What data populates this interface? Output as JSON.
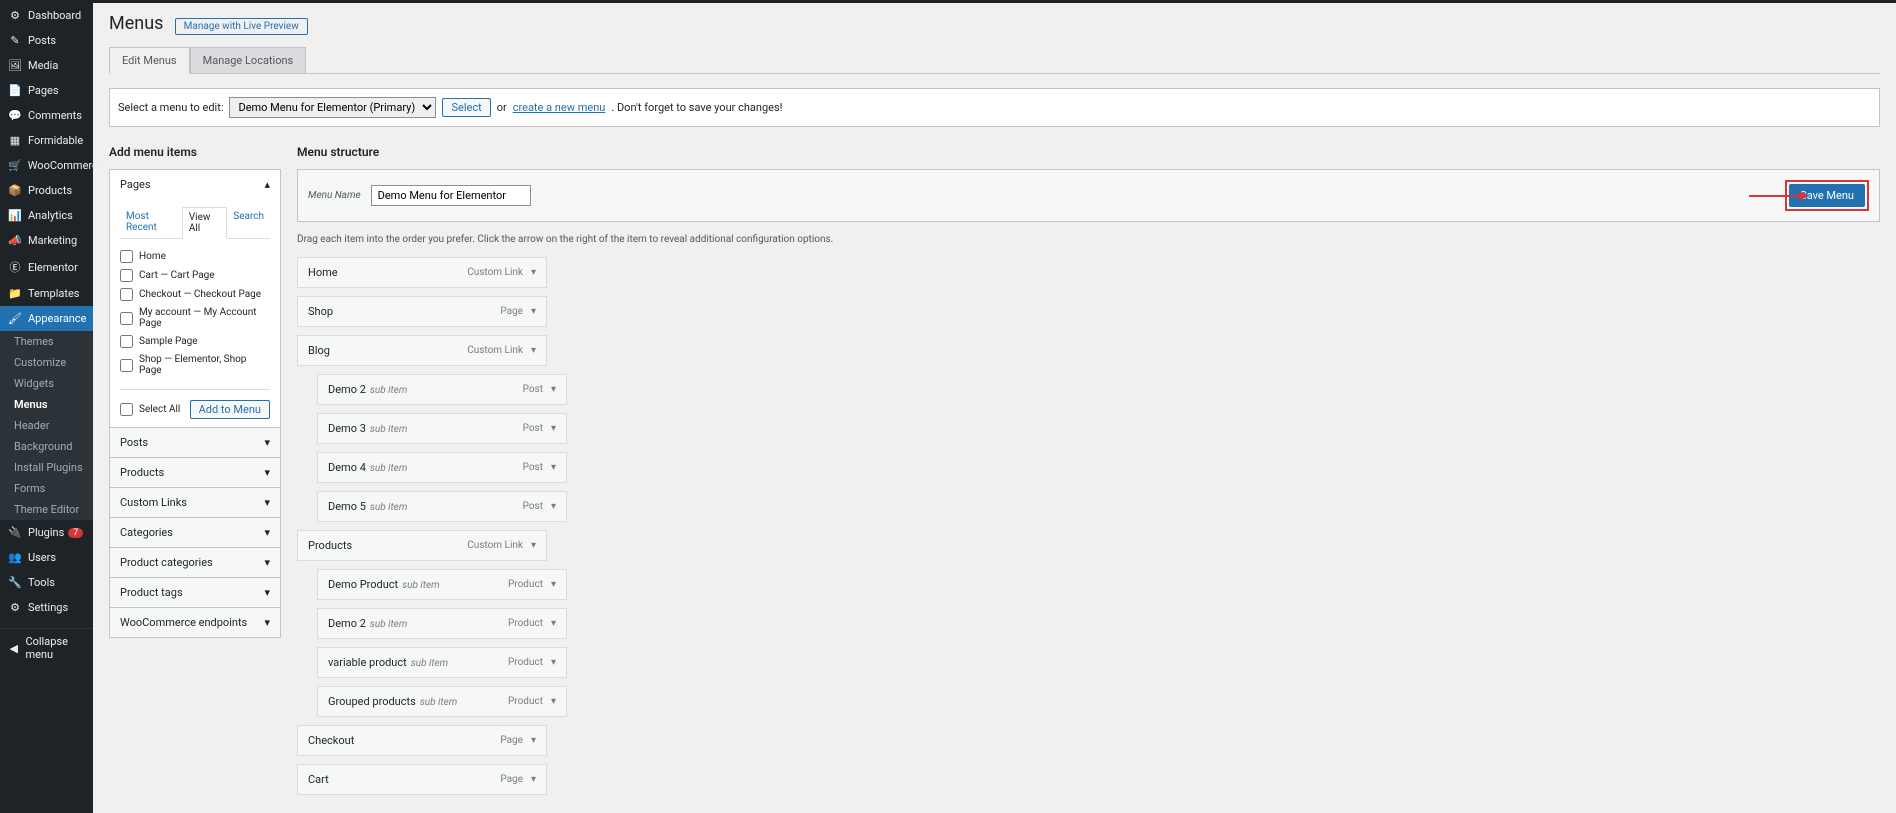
{
  "sidebar": {
    "items": [
      {
        "icon": "⚙",
        "label": "Dashboard"
      },
      {
        "icon": "✎",
        "label": "Posts"
      },
      {
        "icon": "🖼",
        "label": "Media"
      },
      {
        "icon": "📄",
        "label": "Pages"
      },
      {
        "icon": "💬",
        "label": "Comments"
      },
      {
        "icon": "▦",
        "label": "Formidable"
      },
      {
        "icon": "🛒",
        "label": "WooCommerce"
      },
      {
        "icon": "📦",
        "label": "Products"
      },
      {
        "icon": "📊",
        "label": "Analytics"
      },
      {
        "icon": "📣",
        "label": "Marketing"
      },
      {
        "icon": "Ⓔ",
        "label": "Elementor"
      },
      {
        "icon": "📁",
        "label": "Templates"
      },
      {
        "icon": "🖌",
        "label": "Appearance",
        "current": true
      },
      {
        "icon": "🔌",
        "label": "Plugins",
        "badge": "7"
      },
      {
        "icon": "👥",
        "label": "Users"
      },
      {
        "icon": "🔧",
        "label": "Tools"
      },
      {
        "icon": "⚙",
        "label": "Settings"
      }
    ],
    "submenu": [
      "Themes",
      "Customize",
      "Widgets",
      "Menus",
      "Header",
      "Background",
      "Install Plugins",
      "Forms",
      "Theme Editor"
    ],
    "submenu_current": "Menus",
    "collapse_label": "Collapse menu"
  },
  "page": {
    "title": "Menus",
    "title_action": "Manage with Live Preview",
    "tabs": [
      "Edit Menus",
      "Manage Locations"
    ],
    "active_tab": "Edit Menus",
    "select_label": "Select a menu to edit:",
    "select_value": "Demo Menu for Elementor (Primary)",
    "select_btn": "Select",
    "or_text": "or",
    "create_link": "create a new menu",
    "reminder": ". Don't forget to save your changes!"
  },
  "left": {
    "heading": "Add menu items",
    "groups": [
      "Pages",
      "Posts",
      "Products",
      "Custom Links",
      "Categories",
      "Product categories",
      "Product tags",
      "WooCommerce endpoints"
    ],
    "open_group": "Pages",
    "sub_tabs": [
      "Most Recent",
      "View All",
      "Search"
    ],
    "sub_tab_active": "View All",
    "pages": [
      "Home",
      "Cart — Cart Page",
      "Checkout — Checkout Page",
      "My account — My Account Page",
      "Sample Page",
      "Shop — Elementor, Shop Page"
    ],
    "select_all": "Select All",
    "add_btn": "Add to Menu"
  },
  "right": {
    "heading": "Menu structure",
    "name_label": "Menu Name",
    "name_value": "Demo Menu for Elementor",
    "save_btn": "Save Menu",
    "instruct": "Drag each item into the order you prefer. Click the arrow on the right of the item to reveal additional configuration options.",
    "items": [
      {
        "title": "Home",
        "type": "Custom Link",
        "depth": 0
      },
      {
        "title": "Shop",
        "type": "Page",
        "depth": 0
      },
      {
        "title": "Blog",
        "type": "Custom Link",
        "depth": 0
      },
      {
        "title": "Demo 2",
        "sub": "sub item",
        "type": "Post",
        "depth": 1
      },
      {
        "title": "Demo 3",
        "sub": "sub item",
        "type": "Post",
        "depth": 1
      },
      {
        "title": "Demo 4",
        "sub": "sub item",
        "type": "Post",
        "depth": 1
      },
      {
        "title": "Demo 5",
        "sub": "sub item",
        "type": "Post",
        "depth": 1
      },
      {
        "title": "Products",
        "type": "Custom Link",
        "depth": 0
      },
      {
        "title": "Demo Product",
        "sub": "sub item",
        "type": "Product",
        "depth": 1
      },
      {
        "title": "Demo 2",
        "sub": "sub item",
        "type": "Product",
        "depth": 1
      },
      {
        "title": "variable product",
        "sub": "sub item",
        "type": "Product",
        "depth": 1
      },
      {
        "title": "Grouped products",
        "sub": "sub item",
        "type": "Product",
        "depth": 1
      },
      {
        "title": "Checkout",
        "type": "Page",
        "depth": 0
      },
      {
        "title": "Cart",
        "type": "Page",
        "depth": 0
      }
    ]
  }
}
